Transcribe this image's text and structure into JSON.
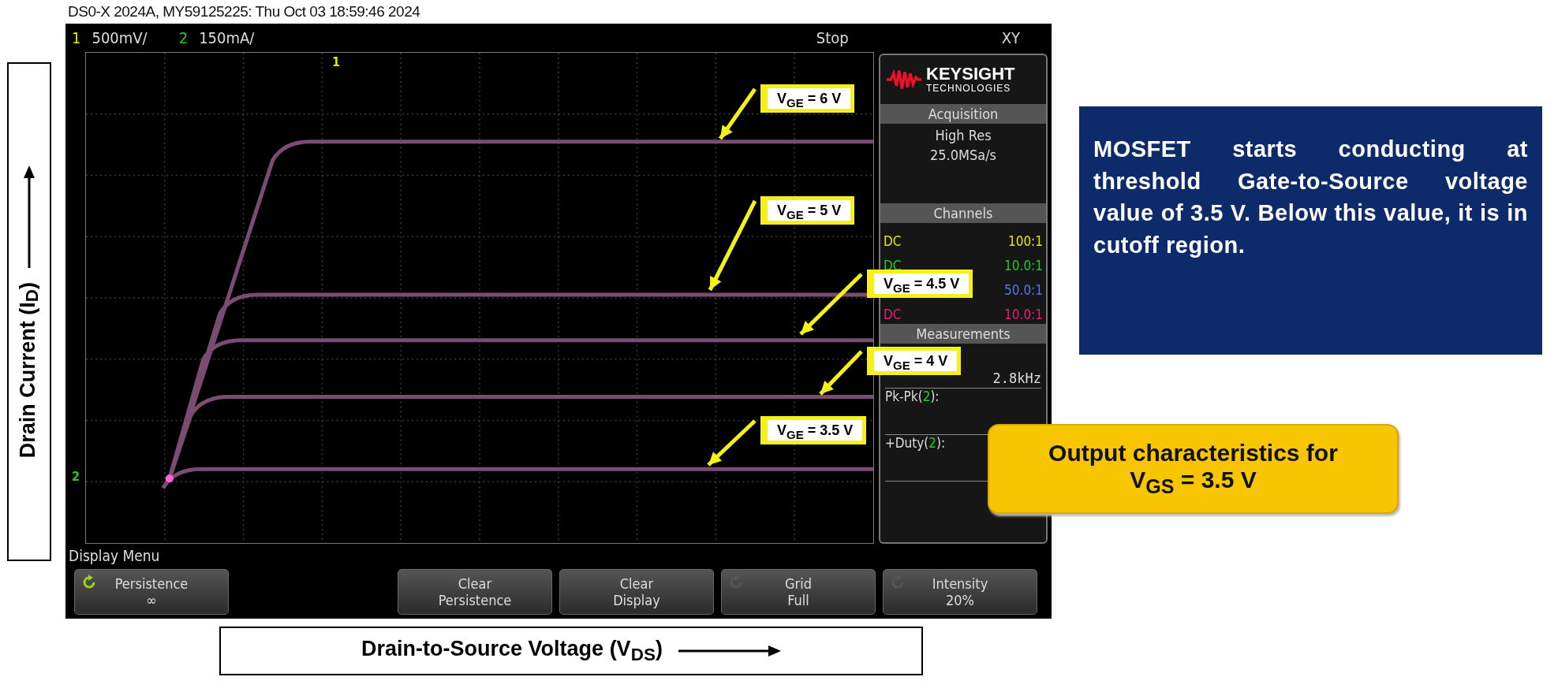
{
  "header": {
    "title": "DS0-X 2024A, MY59125225: Thu Oct 03 18:59:46 2024"
  },
  "scope": {
    "status_bar": {
      "channels": [
        {
          "number": "1",
          "scale": "500mV/",
          "color": "#e6e600"
        },
        {
          "number": "2",
          "scale": "150mA/",
          "color": "#22cc22"
        }
      ],
      "run_state": "Stop",
      "mode": "XY"
    },
    "markers": [
      {
        "label": "1",
        "color": "#e6e600",
        "kind": "top"
      },
      {
        "label": "2",
        "color": "#22cc22",
        "kind": "left"
      }
    ],
    "panel": {
      "logo": {
        "name": "KEYSIGHT",
        "subtitle": "TECHNOLOGIES"
      },
      "acquisition": {
        "title": "Acquisition",
        "mode": "High Res",
        "rate": "25.0MSa/s"
      },
      "channels": {
        "title": "Channels",
        "rows": [
          {
            "coupling": "DC",
            "ratio": "100:1",
            "color": "#e6e600"
          },
          {
            "coupling": "DC",
            "ratio": "10.0:1",
            "color": "#22cc22"
          },
          {
            "ratio": "50.0:1",
            "color": "#5577ee"
          },
          {
            "coupling": "DC",
            "ratio": "10.0:1",
            "color": "#e0207a"
          }
        ]
      },
      "measurements": {
        "title": "Measurements",
        "rows": [
          {
            "value": "2.8kHz"
          },
          {
            "label": "Pk-Pk(",
            "channel": "2",
            "end": "):"
          },
          {
            "label": "+Duty(",
            "channel": "2",
            "end": "):"
          }
        ]
      }
    },
    "menu": {
      "title": "Display Menu",
      "softkeys": [
        {
          "kind": "toggle",
          "enabled": true,
          "label": "Persistence",
          "value": "∞"
        },
        {
          "kind": "action",
          "label": "Clear",
          "value": "Persistence"
        },
        {
          "kind": "action",
          "label": "Clear",
          "value": "Display"
        },
        {
          "kind": "toggle",
          "enabled": false,
          "label": "Grid",
          "value": "Full"
        },
        {
          "kind": "toggle",
          "enabled": false,
          "label": "Intensity",
          "value": "20%"
        }
      ]
    }
  },
  "curve_labels": [
    {
      "text": "V$_{GE}$ = 6 V"
    },
    {
      "text": "V$_{GE}$ = 5 V"
    },
    {
      "text": "V$_{GE}$ = 4.5 V"
    },
    {
      "text": "V$_{GE}$ = 4 V"
    },
    {
      "text": "V$_{GE}$ = 3.5 V"
    }
  ],
  "y_axis_label": "Drain Current (I$_{D}$)",
  "x_axis_label": "Drain-to-Source Voltage (V$_{DS}$)",
  "note": "MOSFET starts conducting at threshold Gate-to-Source voltage value of 3.5 V. Below this value, it is in cutoff region.",
  "callout": [
    "Output characteristics for",
    "V$_{GS}$ = 3.5 V"
  ]
}
